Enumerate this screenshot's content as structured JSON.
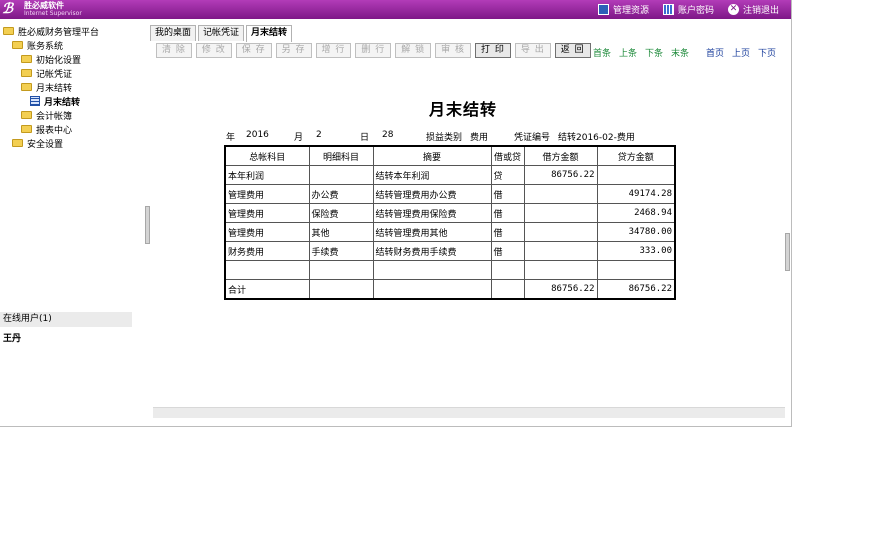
{
  "header": {
    "logo_title": "胜必威软件",
    "logo_subtitle": "Internet Supervisor",
    "links": [
      {
        "label": "管理资源",
        "icon": "resource-icon"
      },
      {
        "label": "账户密码",
        "icon": "account-password-icon"
      },
      {
        "label": "注销退出",
        "icon": "logout-icon"
      }
    ]
  },
  "sidebar": {
    "tree": [
      {
        "label": "胜必威财务管理平台",
        "level": 0,
        "icon": "folder-icon"
      },
      {
        "label": "账务系统",
        "level": 1,
        "icon": "folder-icon"
      },
      {
        "label": "初始化设置",
        "level": 2,
        "icon": "folder-icon"
      },
      {
        "label": "记帐凭证",
        "level": 2,
        "icon": "folder-icon"
      },
      {
        "label": "月末结转",
        "level": 2,
        "icon": "folder-icon"
      },
      {
        "label": "月末结转",
        "level": 3,
        "icon": "grid-icon"
      },
      {
        "label": "会计帐簿",
        "level": 2,
        "icon": "folder-icon"
      },
      {
        "label": "报表中心",
        "level": 2,
        "icon": "folder-icon"
      },
      {
        "label": "安全设置",
        "level": 1,
        "icon": "folder-icon"
      }
    ],
    "online_label": "在线用户",
    "online_count": "(1)",
    "user": "王丹"
  },
  "tabs": [
    {
      "label": "我的桌面",
      "active": false
    },
    {
      "label": "记帐凭证",
      "active": false
    },
    {
      "label": "月末结转",
      "active": true
    }
  ],
  "toolbar": [
    {
      "label": "清 除",
      "enabled": false
    },
    {
      "label": "修 改",
      "enabled": false
    },
    {
      "label": "保 存",
      "enabled": false
    },
    {
      "label": "另 存",
      "enabled": false
    },
    {
      "label": "增 行",
      "enabled": false
    },
    {
      "label": "删 行",
      "enabled": false
    },
    {
      "label": "解 锁",
      "enabled": false
    },
    {
      "label": "审 核",
      "enabled": false
    },
    {
      "label": "打 印",
      "enabled": true
    },
    {
      "label": "导 出",
      "enabled": false
    },
    {
      "label": "返 回",
      "enabled": true
    }
  ],
  "record_nav": [
    "首条",
    "上条",
    "下条",
    "末条"
  ],
  "page_nav": [
    "首页",
    "上页",
    "下页"
  ],
  "document": {
    "title": "月末结转",
    "year_label": "年",
    "year": "2016",
    "month_label": "月",
    "month": "2",
    "day_label": "日",
    "day": "28",
    "type_label": "损益类别",
    "type": "费用",
    "voucher_label": "凭证编号",
    "voucher": "结转2016-02-费用"
  },
  "table": {
    "headers": [
      "总帐科目",
      "明细科目",
      "摘要",
      "借或贷",
      "借方金额",
      "贷方金额"
    ],
    "rows": [
      [
        "本年利润",
        "",
        "结转本年利润",
        "贷",
        "86756.22",
        ""
      ],
      [
        "管理费用",
        "办公费",
        "结转管理费用办公费",
        "借",
        "",
        "49174.28"
      ],
      [
        "管理费用",
        "保险费",
        "结转管理费用保险费",
        "借",
        "",
        "2468.94"
      ],
      [
        "管理费用",
        "其他",
        "结转管理费用其他",
        "借",
        "",
        "34780.00"
      ],
      [
        "财务费用",
        "手续费",
        "结转财务费用手续费",
        "借",
        "",
        "333.00"
      ],
      [
        "",
        "",
        "",
        "",
        "",
        ""
      ]
    ],
    "total": [
      "合计",
      "",
      "",
      "",
      "86756.22",
      "86756.22"
    ]
  }
}
